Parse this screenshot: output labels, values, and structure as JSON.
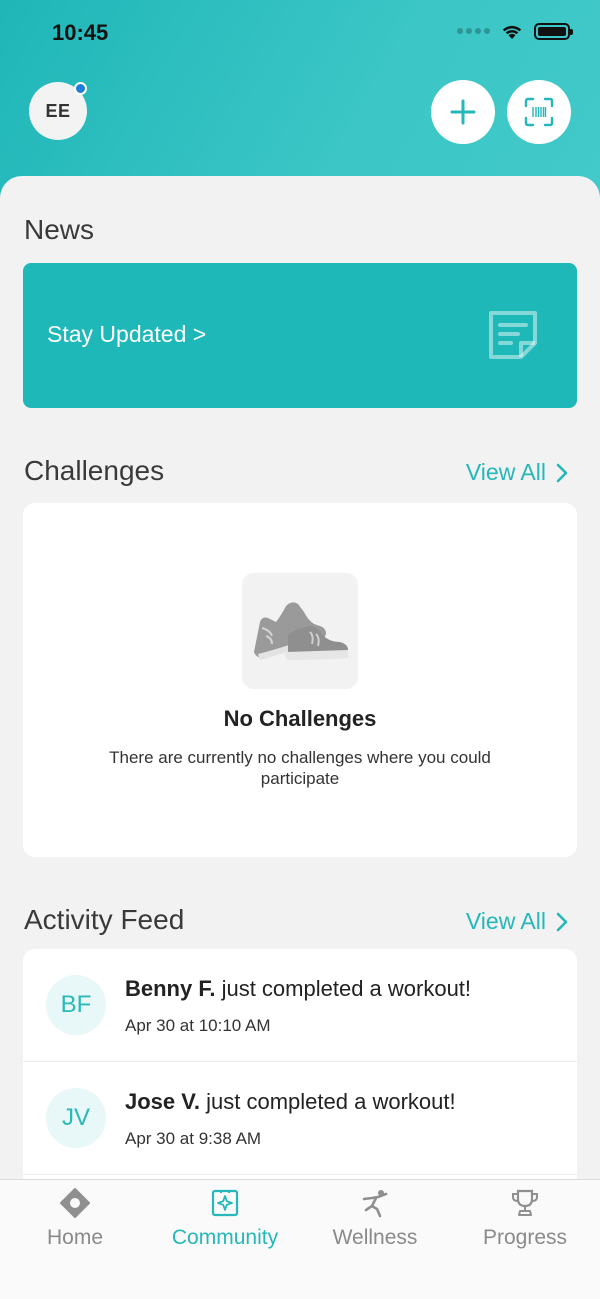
{
  "status_bar": {
    "time": "10:45"
  },
  "header": {
    "avatar_initials": "EE",
    "add_icon": "plus-icon",
    "scan_icon": "barcode-scan-icon"
  },
  "news": {
    "title": "News",
    "banner_text": "Stay Updated >",
    "banner_icon": "note-icon"
  },
  "challenges": {
    "title": "Challenges",
    "view_all": "View All",
    "empty_title": "No Challenges",
    "empty_description": "There are currently no challenges where you could participate"
  },
  "activity_feed": {
    "title": "Activity Feed",
    "view_all": "View All",
    "items": [
      {
        "initials": "BF",
        "name": "Benny F.",
        "action": " just completed a workout!",
        "time": "Apr 30 at 10:10 AM"
      },
      {
        "initials": "JV",
        "name": "Jose V.",
        "action": " just completed a workout!",
        "time": "Apr 30 at 9:38 AM"
      }
    ]
  },
  "tabs": [
    {
      "label": "Home",
      "icon": "home-icon",
      "active": false
    },
    {
      "label": "Community",
      "icon": "community-icon",
      "active": true
    },
    {
      "label": "Wellness",
      "icon": "wellness-icon",
      "active": false
    },
    {
      "label": "Progress",
      "icon": "trophy-icon",
      "active": false
    }
  ],
  "colors": {
    "accent": "#25b7b9",
    "header_bg": "#2fbfc0",
    "sheet_bg": "#f2f2f2",
    "notification_dot": "#1e7ed8"
  }
}
